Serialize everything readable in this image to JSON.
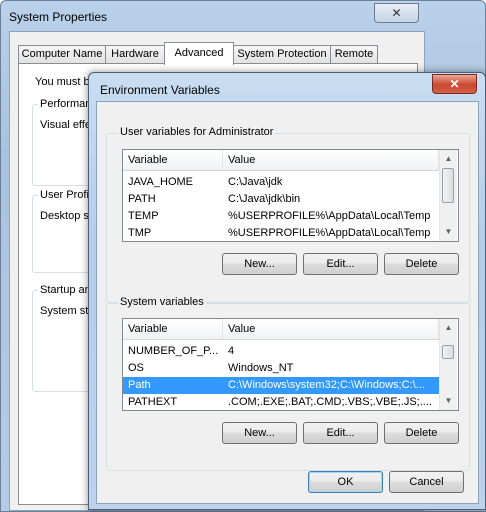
{
  "system_properties": {
    "title": "System Properties",
    "close_glyph": "✕",
    "tabs": [
      {
        "label": "Computer Name"
      },
      {
        "label": "Hardware"
      },
      {
        "label": "Advanced"
      },
      {
        "label": "System Protection"
      },
      {
        "label": "Remote"
      }
    ],
    "active_tab": "Advanced",
    "intro_text": "You must be",
    "performance": {
      "label": "Performance",
      "desc": "Visual effec"
    },
    "user_profiles": {
      "label": "User Profile",
      "desc": "Desktop se"
    },
    "startup": {
      "label": "Startup and",
      "desc": "System star"
    }
  },
  "env_dialog": {
    "title": "Environment Variables",
    "close_glyph": "✕",
    "user_vars": {
      "group_label": "User variables for Administrator",
      "columns": {
        "variable": "Variable",
        "value": "Value"
      },
      "rows": [
        {
          "variable": "JAVA_HOME",
          "value": "C:\\Java\\jdk"
        },
        {
          "variable": "PATH",
          "value": "C:\\Java\\jdk\\bin"
        },
        {
          "variable": "TEMP",
          "value": "%USERPROFILE%\\AppData\\Local\\Temp"
        },
        {
          "variable": "TMP",
          "value": "%USERPROFILE%\\AppData\\Local\\Temp"
        }
      ],
      "buttons": {
        "new": "New...",
        "edit": "Edit...",
        "delete": "Delete"
      }
    },
    "system_vars": {
      "group_label": "System variables",
      "columns": {
        "variable": "Variable",
        "value": "Value"
      },
      "rows": [
        {
          "variable": "NUMBER_OF_P...",
          "value": "4"
        },
        {
          "variable": "OS",
          "value": "Windows_NT"
        },
        {
          "variable": "Path",
          "value": "C:\\Windows\\system32;C:\\Windows;C:\\..."
        },
        {
          "variable": "PATHEXT",
          "value": ".COM;.EXE;.BAT;.CMD;.VBS;.VBE;.JS;...."
        }
      ],
      "selected_variable": "Path",
      "buttons": {
        "new": "New...",
        "edit": "Edit...",
        "delete": "Delete"
      }
    },
    "ok_label": "OK",
    "cancel_label": "Cancel"
  },
  "scroll_glyphs": {
    "up": "▲",
    "down": "▼"
  },
  "colors": {
    "selection": "#3399ff",
    "dialog_close": "#c8472e",
    "window_frame": "#b9d1ea"
  }
}
